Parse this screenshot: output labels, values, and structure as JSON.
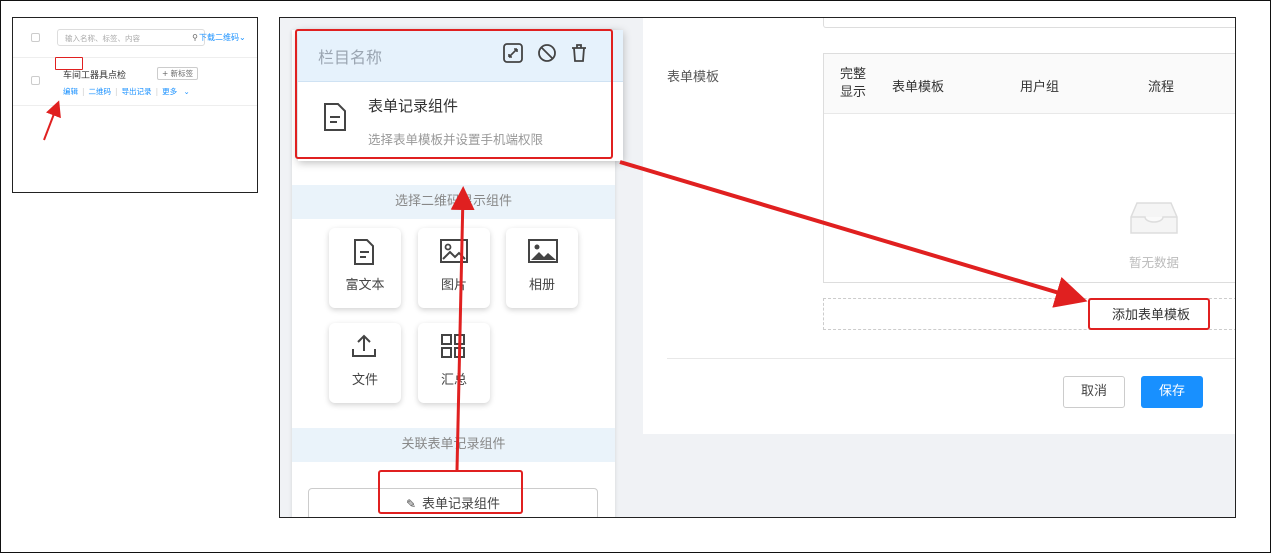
{
  "thumbnail": {
    "search_placeholder": "输入名称、标签、内容",
    "download_label": "下载二维码",
    "item_title": "车间工器具点检",
    "add_tag_label": "+ 新标签",
    "actions": [
      "编辑",
      "二维码",
      "导出记录",
      "更多"
    ]
  },
  "editor": {
    "column_name": "栏目名称",
    "selected_component_title": "表单记录组件",
    "selected_component_desc": "选择表单模板并设置手机端权限",
    "section_qr": "选择二维码显示组件",
    "tiles": [
      {
        "label": "富文本",
        "icon": "document-icon"
      },
      {
        "label": "图片",
        "icon": "image-icon"
      },
      {
        "label": "相册",
        "icon": "album-icon"
      },
      {
        "label": "文件",
        "icon": "upload-icon"
      },
      {
        "label": "汇总",
        "icon": "grid-icon"
      }
    ],
    "section_form": "关联表单记录组件",
    "form_button": "表单记录组件"
  },
  "form_panel": {
    "label": "表单模板",
    "columns": {
      "full_display_line1": "完整",
      "full_display_line2": "显示",
      "template": "表单模板",
      "user_group": "用户组",
      "process": "流程"
    },
    "empty_text": "暂无数据",
    "add_label": "添加表单模板",
    "cancel_label": "取消",
    "save_label": "保存"
  },
  "colors": {
    "accent": "#1890ff",
    "highlight": "#e02020"
  }
}
